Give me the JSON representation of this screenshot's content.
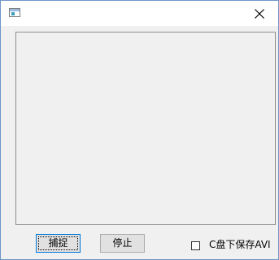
{
  "window": {
    "icon": "app-window-icon",
    "close_icon": "close-icon"
  },
  "buttons": {
    "capture_label": "捕捉",
    "stop_label": "停止"
  },
  "options": {
    "save_avi_label": "C盘下保存AVI",
    "save_avi_checked": false
  }
}
